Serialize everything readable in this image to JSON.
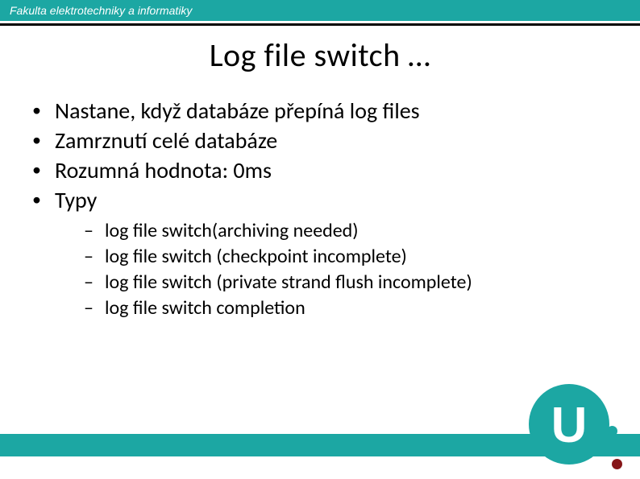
{
  "header": {
    "faculty": "Fakulta elektrotechniky a informatiky"
  },
  "title": "Log file switch …",
  "bullets": {
    "b0": "Nastane, když databáze přepíná log files",
    "b1": "Zamrznutí celé databáze",
    "b2": "Rozumná hodnota: 0ms",
    "b3": "Typy"
  },
  "sub": {
    "s0": "log file switch(archiving needed)",
    "s1": "log file switch (checkpoint incomplete)",
    "s2": "log file switch (private strand flush incomplete)",
    "s3": "log file switch completion"
  },
  "logo": {
    "letter": "U"
  }
}
